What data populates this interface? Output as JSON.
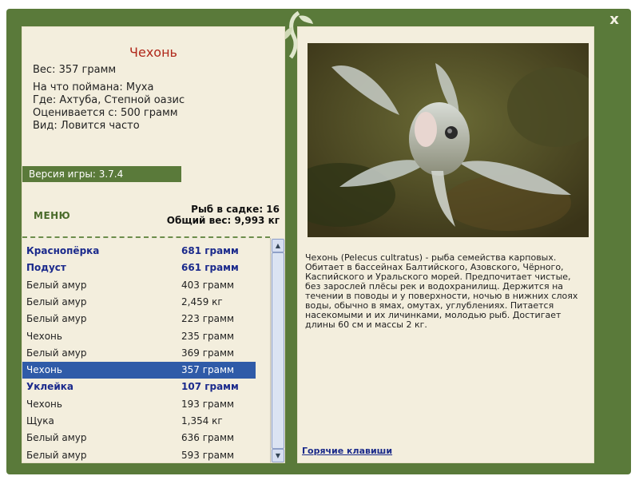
{
  "close_label": "x",
  "fish": {
    "title": "Чехонь",
    "weight": "Вес: 357 грамм",
    "bait": "На что поймана: Муха",
    "location": "Где: Ахтуба, Степной оазис",
    "value": "Оценивается с: 500 грамм",
    "kind": "Вид: Ловится часто"
  },
  "version_label": "Версия игры: 3.7.4",
  "menu_label": "МЕНЮ",
  "stats": {
    "fish_count": "Рыб в садке: 16",
    "total_weight": "Общий вес: 9,993 кг"
  },
  "catch_list": [
    {
      "name": "Краснопёрка",
      "weight": "681 грамм",
      "bold": true
    },
    {
      "name": "Подуст",
      "weight": "661 грамм",
      "bold": true
    },
    {
      "name": "Белый амур",
      "weight": "403 грамм"
    },
    {
      "name": "Белый амур",
      "weight": "2,459 кг"
    },
    {
      "name": "Белый амур",
      "weight": "223 грамм"
    },
    {
      "name": "Чехонь",
      "weight": "235 грамм"
    },
    {
      "name": "Белый амур",
      "weight": "369 грамм"
    },
    {
      "name": "Чехонь",
      "weight": "357 грамм",
      "selected": true
    },
    {
      "name": "Уклейка",
      "weight": "107 грамм",
      "bold": true
    },
    {
      "name": "Чехонь",
      "weight": "193 грамм"
    },
    {
      "name": "Щука",
      "weight": "1,354 кг"
    },
    {
      "name": "Белый амур",
      "weight": "636 грамм"
    },
    {
      "name": "Белый амур",
      "weight": "593 грамм"
    }
  ],
  "description": "Чехонь (Pelecus cultratus) - рыба семейства карповых. Обитает в бассейнах Балтийского, Азовского, Чёрного, Каспийского и Уральского морей. Предпочитает чистые, без зарослей плёсы рек и водохранилищ. Держится на течении в поводы и у поверхности, ночью в нижних слоях воды, обычно в ямах, омутах, углублениях. Питается насекомыми и их личинками, молодью рыб. Достигает длины 60 см и массы 2 кг.",
  "hotkeys_label": "Горячие клавиши",
  "colors": {
    "frame": "#5a7a3a",
    "panel": "#f3eedd",
    "title": "#b0281a",
    "highlight": "#1b2a8c",
    "selection": "#2f5ba8"
  }
}
